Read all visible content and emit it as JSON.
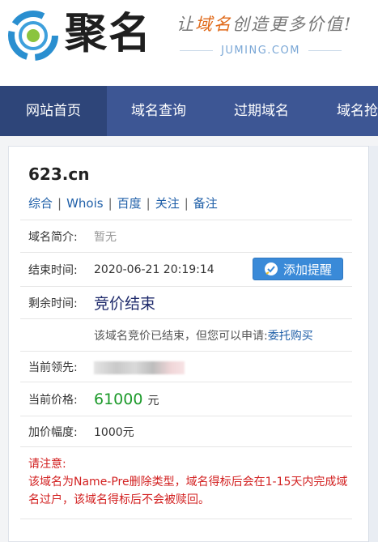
{
  "brand": {
    "name": "聚名",
    "slogan_pre": "让",
    "slogan_hl": "域名",
    "slogan_post": "创造更多价值!",
    "domain": "JUMING.COM"
  },
  "nav": {
    "items": [
      {
        "label": "网站首页"
      },
      {
        "label": "域名查询"
      },
      {
        "label": "过期域名"
      },
      {
        "label": "域名抢"
      }
    ]
  },
  "detail": {
    "domain": "623.cn",
    "links": [
      {
        "label": "综合"
      },
      {
        "label": "Whois"
      },
      {
        "label": "百度"
      },
      {
        "label": "关注"
      },
      {
        "label": "备注"
      }
    ],
    "separator": "|",
    "intro_label": "域名简介:",
    "intro_value": "暂无",
    "end_label": "结束时间:",
    "end_value": "2020-06-21 20:19:14",
    "remind_button": "添加提醒",
    "remaining_label": "剩余时间:",
    "remaining_value": "竞价结束",
    "ended_note": "该域名竞价已结束，但您可以申请:",
    "ended_link": "委托购买",
    "leader_label": "当前领先:",
    "price_label": "当前价格:",
    "price_value": "61000",
    "price_unit": "元",
    "increment_label": "加价幅度:",
    "increment_value": "1000元",
    "warning_title": "请注意:",
    "warning_text": "该域名为Name-Pre删除类型，域名得标后会在1-15天内完成域名过户，该域名得标后不会被赎回。"
  },
  "colors": {
    "nav_bg": "#3d5694",
    "nav_active": "#2e4579",
    "link": "#1f5fa8",
    "price": "#1d9a2b",
    "warning": "#d21f1f",
    "button": "#3a8ad8"
  },
  "icons": {
    "logo": "juming-logo-icon",
    "remind": "check-bubble-icon"
  }
}
